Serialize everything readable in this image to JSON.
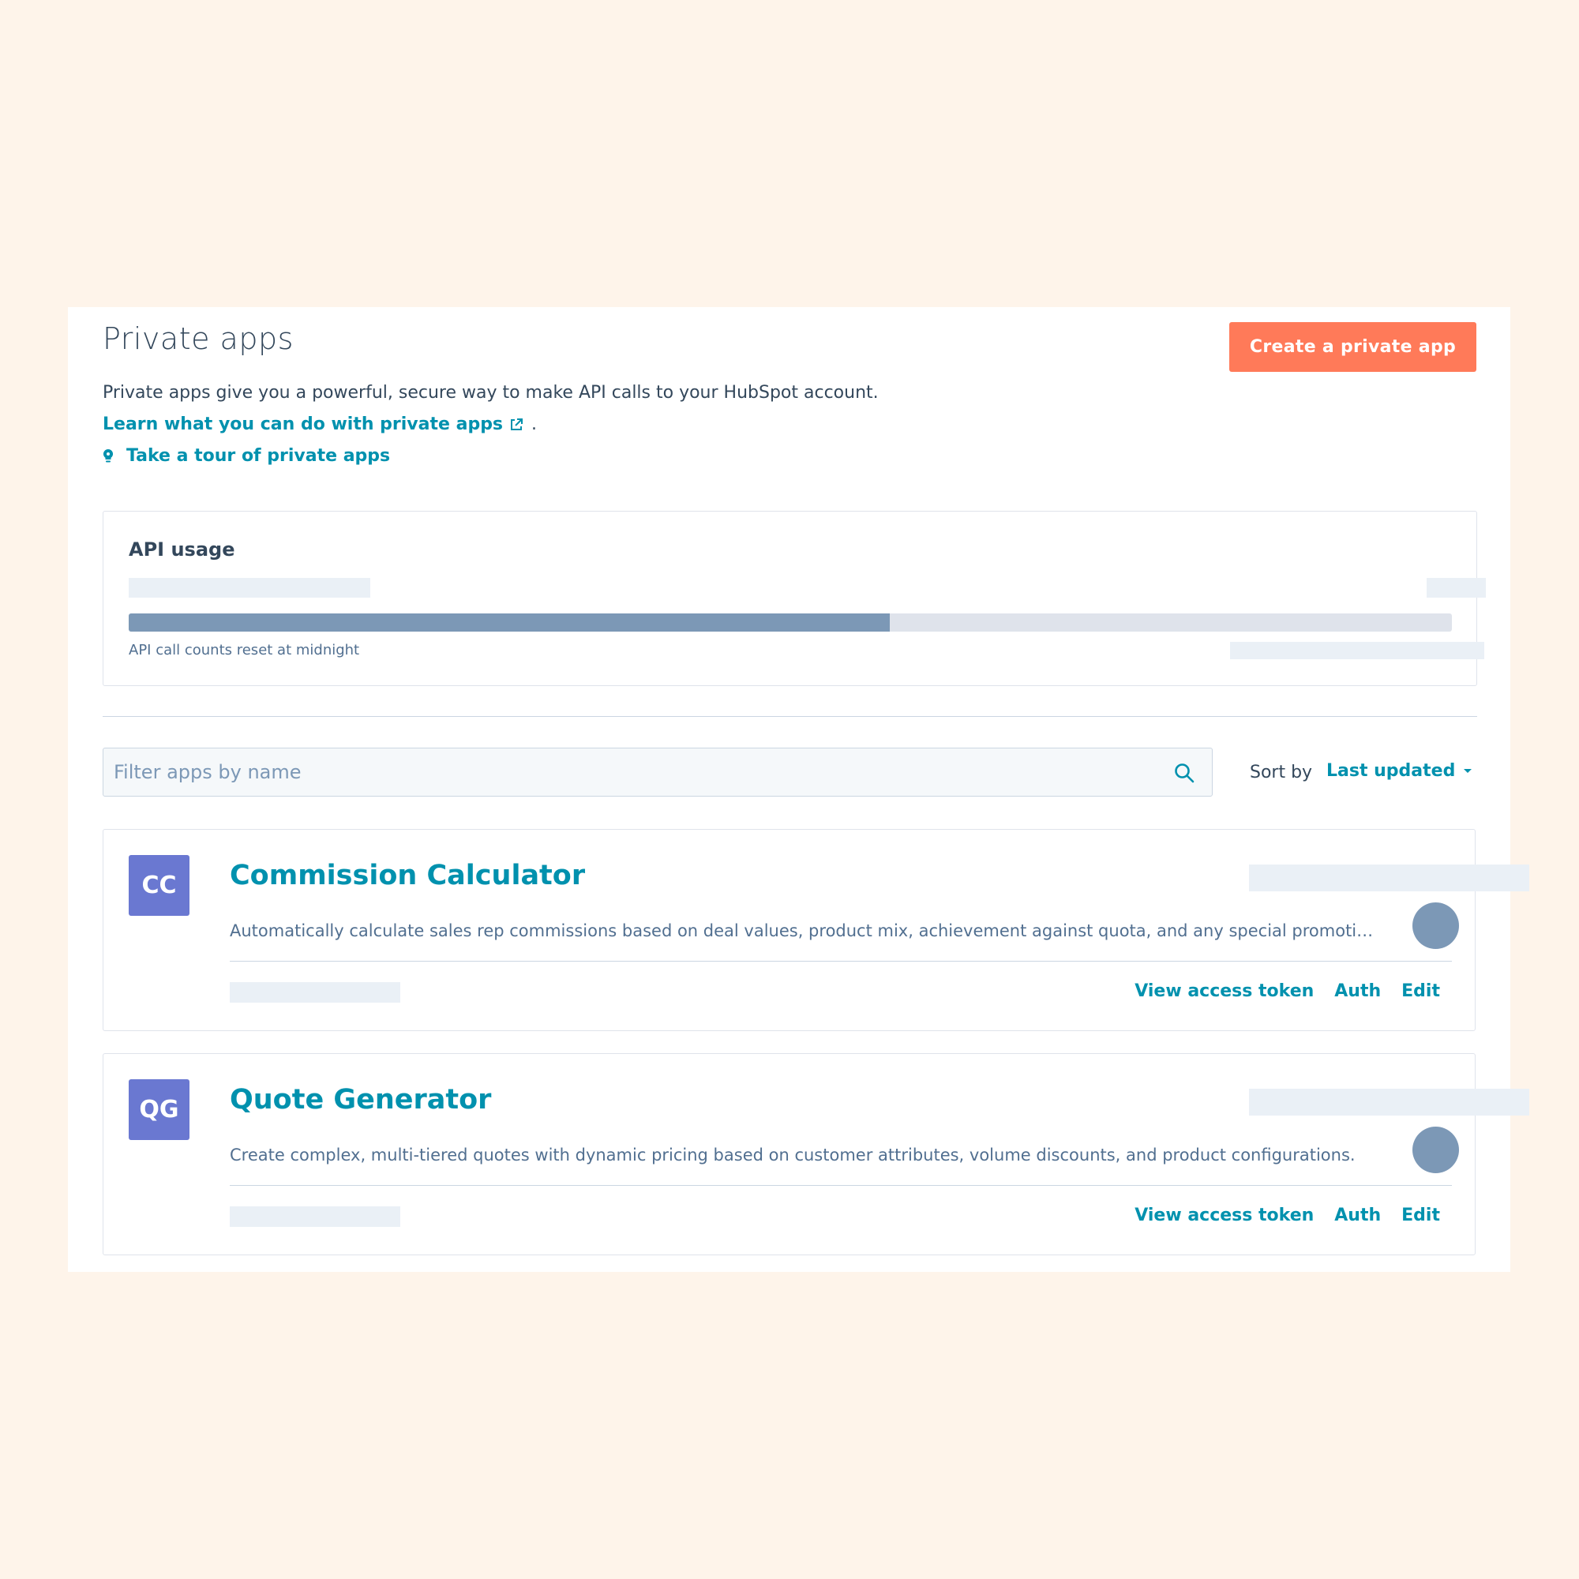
{
  "header": {
    "title": "Private apps",
    "create_button": "Create a private app",
    "intro": "Private apps give you a powerful, secure way to make API calls to your HubSpot account.",
    "learn_link": "Learn what you can do with private apps",
    "learn_suffix": ".",
    "tour_link": "Take a tour of private apps"
  },
  "usage": {
    "title": "API usage",
    "progress_fraction": 0.575,
    "reset_note": "API call counts reset at midnight"
  },
  "filter": {
    "placeholder": "Filter apps by name",
    "value": "",
    "sort_label": "Sort by",
    "sort_value": "Last updated"
  },
  "apps": [
    {
      "initials": "CC",
      "name": "Commission Calculator",
      "description": "Automatically calculate sales rep commissions based on deal values, product mix, achievement against quota, and any special promotions",
      "actions": [
        "View access token",
        "Auth",
        "Edit"
      ]
    },
    {
      "initials": "QG",
      "name": "Quote Generator",
      "description": "Create complex, multi-tiered quotes with dynamic pricing based on customer attributes, volume discounts, and product configurations.",
      "actions": [
        "View access token",
        "Auth",
        "Edit"
      ]
    }
  ],
  "colors": {
    "accent": "#0091ae",
    "primary_button": "#ff7a59",
    "avatar": "#6a78d1",
    "progress_fill": "#7c98b6",
    "background": "#fef4ea"
  },
  "icons": {
    "external_link": "external-link-icon",
    "tour": "lightbulb-icon",
    "search": "search-icon",
    "sort_caret": "caret-down-icon"
  }
}
